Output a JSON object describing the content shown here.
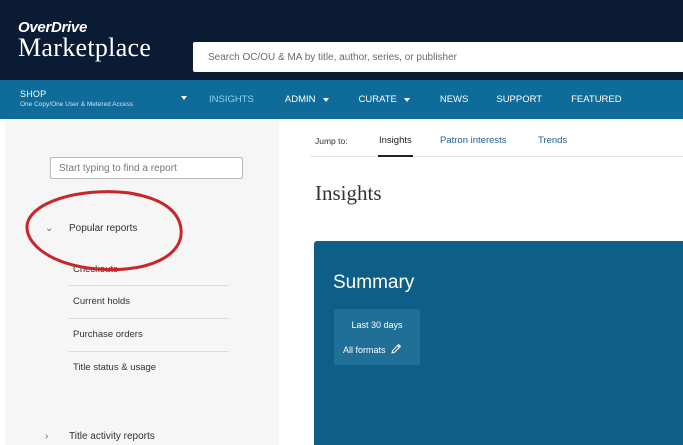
{
  "header": {
    "brand": "OverDrive",
    "product": "Marketplace",
    "search_placeholder": "Search OC/OU & MA by title, author, series, or publisher"
  },
  "nav": {
    "shop_title": "SHOP",
    "shop_subtitle": "One Copy/One User & Metered Access",
    "items": [
      {
        "label": "INSIGHTS",
        "active": true
      },
      {
        "label": "ADMIN"
      },
      {
        "label": "CURATE"
      },
      {
        "label": "NEWS"
      },
      {
        "label": "SUPPORT"
      },
      {
        "label": "FEATURED"
      }
    ]
  },
  "sidebar": {
    "search_placeholder": "Start typing to find a report",
    "sections": [
      {
        "label": "Popular reports",
        "expanded": true,
        "items": [
          "Checkouts",
          "Current holds",
          "Purchase orders",
          "Title status & usage"
        ]
      },
      {
        "label": "Title activity reports",
        "expanded": false
      }
    ]
  },
  "jump": {
    "label": "Jump to:",
    "tabs": [
      "Insights",
      "Patron interests",
      "Trends"
    ],
    "active": "Insights"
  },
  "main": {
    "title": "Insights",
    "summary": {
      "title": "Summary",
      "period": "Last 30 days",
      "formats": "All formats"
    }
  },
  "colors": {
    "header_bg": "#0b1b33",
    "nav_bg": "#0e6b9a",
    "nav_active": "#8fd1f0",
    "summary_bg": "#0d5f88",
    "annotation": "#c8262b"
  }
}
